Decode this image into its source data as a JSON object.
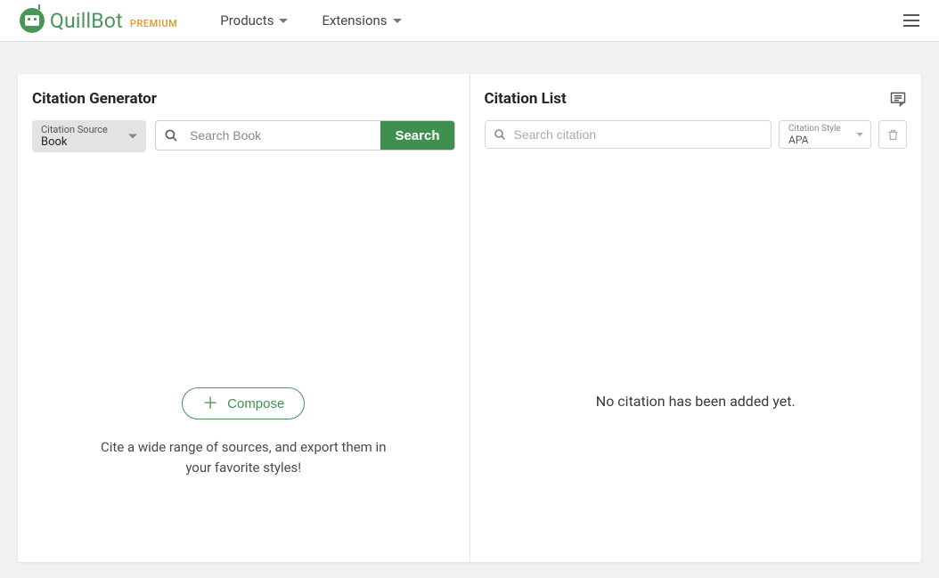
{
  "header": {
    "brand": "QuillBot",
    "premium": "PREMIUM",
    "nav": {
      "products": "Products",
      "extensions": "Extensions"
    }
  },
  "left": {
    "title": "Citation Generator",
    "source": {
      "label": "Citation Source",
      "value": "Book"
    },
    "search": {
      "placeholder": "Search Book",
      "button": "Search"
    },
    "compose": {
      "button": "Compose",
      "desc": "Cite a wide range of sources, and export them in your favorite styles!"
    }
  },
  "right": {
    "title": "Citation List",
    "search": {
      "placeholder": "Search citation"
    },
    "style": {
      "label": "Citation Style",
      "value": "APA"
    },
    "empty": "No citation has been added yet."
  }
}
